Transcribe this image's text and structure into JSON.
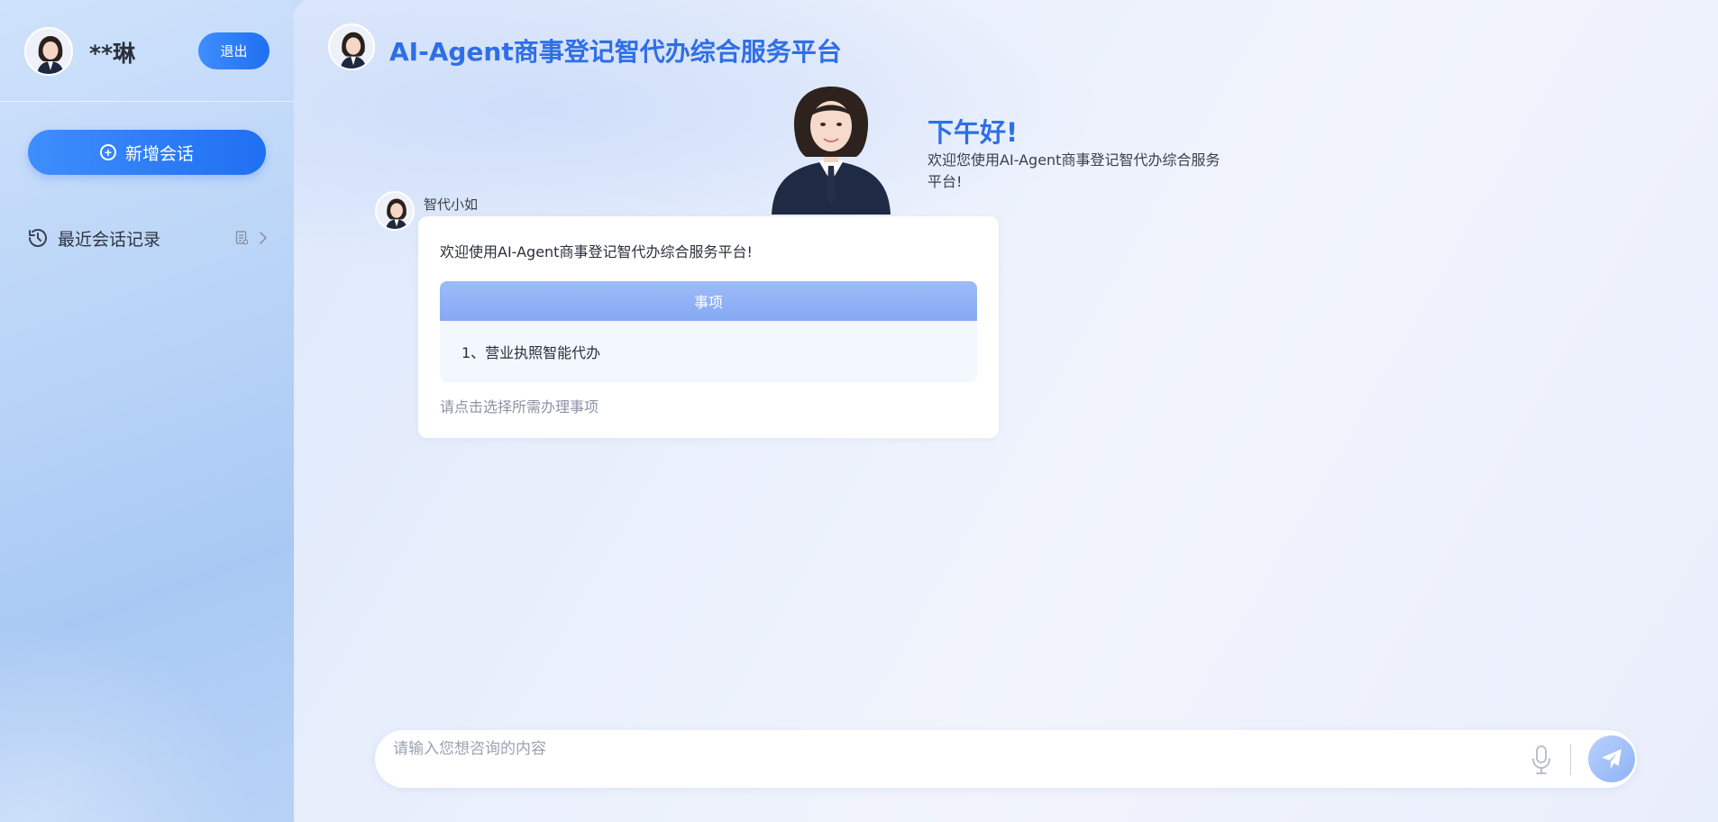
{
  "sidebar": {
    "user_name": "**琳",
    "logout_label": "退出",
    "new_chat_label": "新增会话",
    "history_label": "最近会话记录",
    "icons": {
      "avatar": "avatar-icon",
      "plus": "plus-circle-icon",
      "history": "history-clock-icon",
      "document": "document-icon",
      "chevron": "chevron-right-icon"
    }
  },
  "header": {
    "title": "AI-Agent商事登记智代办综合服务平台"
  },
  "greeting": {
    "title": "下午好!",
    "text": "欢迎您使用AI-Agent商事登记智代办综合服务平台!"
  },
  "bot": {
    "name": "智代小如",
    "intro": "欢迎使用AI-Agent商事登记智代办综合服务平台!",
    "table_header": "事项",
    "items": [
      {
        "label": "1、营业执照智能代办"
      }
    ],
    "hint": "请点击选择所需办理事项"
  },
  "input": {
    "placeholder": "请输入您想咨询的内容",
    "value": ""
  },
  "colors": {
    "accent": "#1f6ff2",
    "title_blue": "#2f6fe6",
    "table_header": "#8eaef5"
  }
}
